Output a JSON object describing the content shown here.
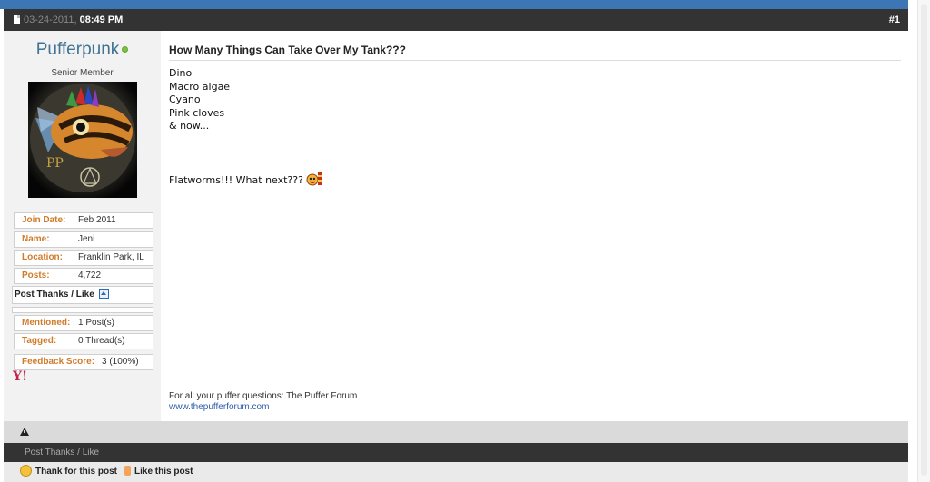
{
  "post": {
    "date": "03-24-2011,",
    "time": "08:49 PM",
    "number": "#1",
    "title": "How Many Things Can Take Over My Tank???",
    "message_lines": [
      "Dino",
      "Macro algae",
      "Cyano",
      "Pink cloves",
      "& now..."
    ],
    "closing_line": "Flatworms!!! What next???",
    "signature_text": "For all your puffer questions: The Puffer Forum",
    "signature_link": "www.thepufferforum.com"
  },
  "user": {
    "name": "Pufferpunk",
    "title": "Senior Member",
    "join_date_label": "Join Date:",
    "join_date": "Feb 2011",
    "name_label": "Name:",
    "real_name": "Jeni",
    "location_label": "Location:",
    "location": "Franklin Park, IL",
    "posts_label": "Posts:",
    "posts": "4,722",
    "thanks_label": "Post Thanks / Like",
    "mentioned_label": "Mentioned:",
    "mentioned": "1 Post(s)",
    "tagged_label": "Tagged:",
    "tagged": "0 Thread(s)",
    "feedback_label": "Feedback Score:",
    "feedback": "3 (100%)"
  },
  "footer": {
    "thanks_bar": "Post Thanks / Like",
    "thank_button": "Thank for this post",
    "like_button": "Like this post"
  },
  "icons": {
    "doc": "document-icon",
    "online": "online-status-icon",
    "thanks_toggle": "expand-up-icon",
    "yahoo": "yahoo-messenger-icon",
    "smiley": "crazy-smiley-icon",
    "report": "report-warning-icon",
    "thank": "thank-smile-icon",
    "like": "like-thumb-icon"
  },
  "colors": {
    "header_bg": "#333333",
    "top_accent": "#3c76b4",
    "username": "#417394",
    "label_orange": "#d07b2a",
    "link_blue": "#2d5da8",
    "online_green": "#7cc242"
  }
}
